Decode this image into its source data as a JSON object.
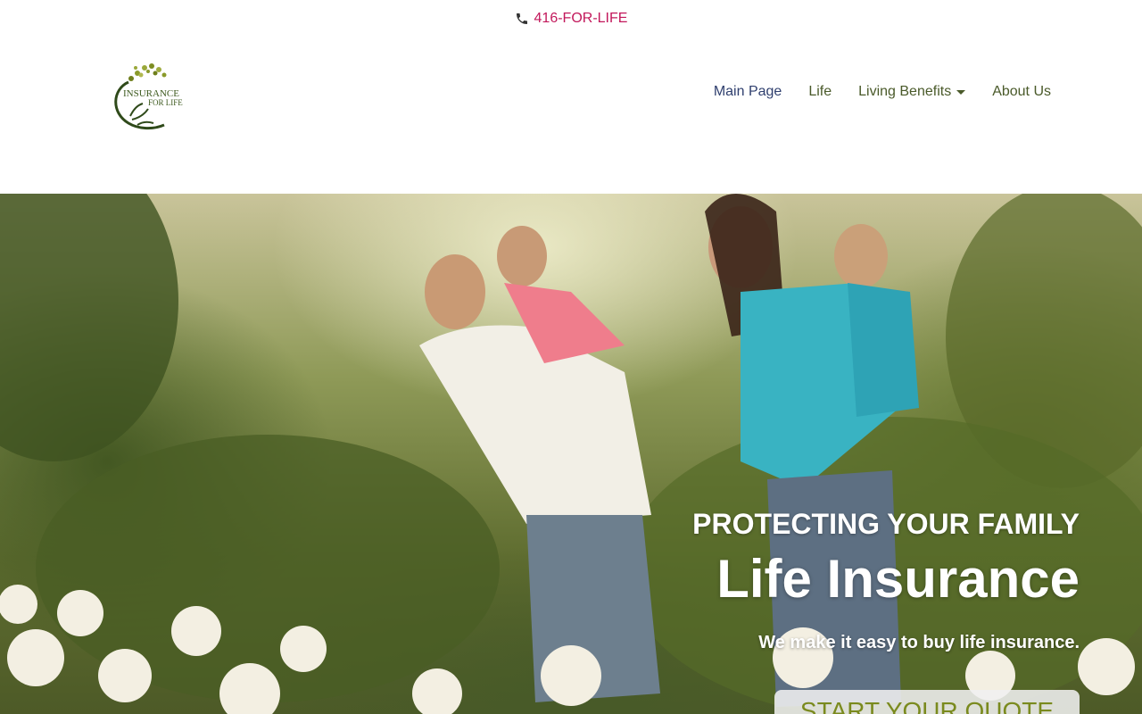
{
  "topbar": {
    "phone": "416-FOR-LIFE",
    "icon": "phone-icon"
  },
  "logo": {
    "line1": "INSURANCE",
    "line2": "FOR LIFE"
  },
  "nav": {
    "items": [
      {
        "label": "Main Page"
      },
      {
        "label": "Life"
      },
      {
        "label": "Living Benefits",
        "has_dropdown": true
      },
      {
        "label": "About Us"
      }
    ]
  },
  "hero": {
    "eyebrow": "PROTECTING YOUR FAMILY",
    "headline": "Life Insurance",
    "tagline": "We make it easy to buy life insurance.",
    "cta": "START YOUR QUOTE"
  },
  "colors": {
    "phone": "#c2185b",
    "nav": "#4a5a2a",
    "nav_active": "#2f3f6e",
    "cta_text": "#7a8a1e"
  }
}
